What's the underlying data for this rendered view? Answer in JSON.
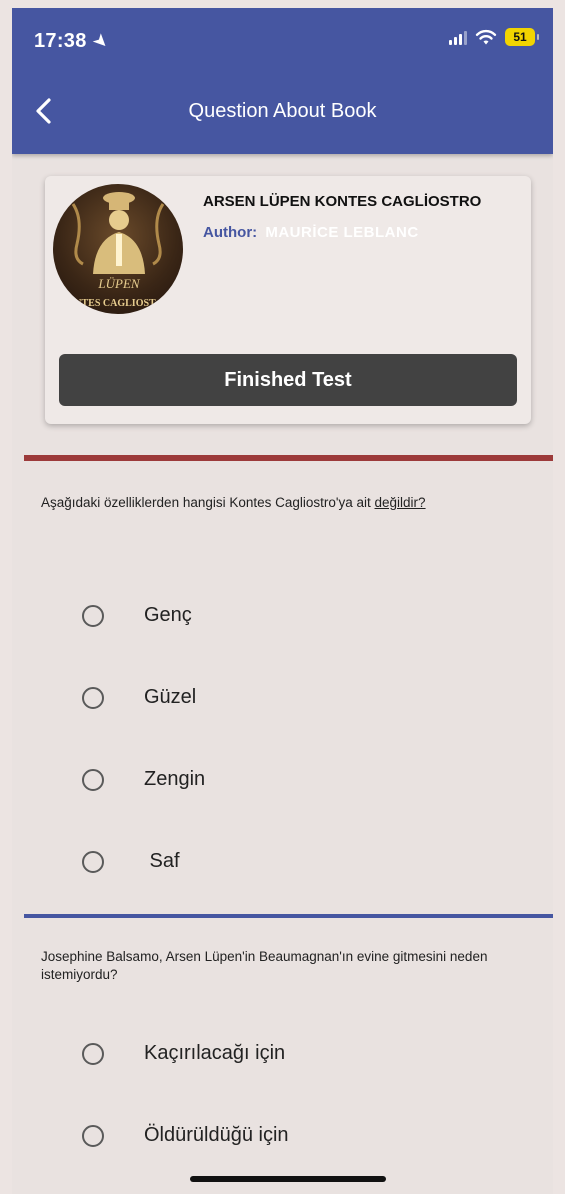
{
  "status_bar": {
    "time": "17:38",
    "battery": "51"
  },
  "header": {
    "title": "Question About Book"
  },
  "book": {
    "title": "ARSEN LÜPEN KONTES CAGLİOSTRO",
    "author_label": "Author:",
    "author_name": "MAURİCE LEBLANC",
    "cover_lines": [
      "LÜPEN",
      "NTES CAGLIOST"
    ]
  },
  "finish_button": {
    "label": "Finished Test"
  },
  "questions": [
    {
      "text_before": "Aşağıdaki özelliklerden hangisi Kontes Cagliostro'ya ait ",
      "text_underlined": "değildir?",
      "options": [
        "Genç",
        "Güzel",
        "Zengin",
        " Saf"
      ]
    },
    {
      "text": "Josephine Balsamo, Arsen Lüpen'in Beaumagnan'ın evine gitmesini neden istemiyordu?",
      "options": [
        "Kaçırılacağı için",
        "Öldürüldüğü için"
      ]
    }
  ],
  "colors": {
    "appbar": "#4656a1",
    "divider_red": "#9c3a3a",
    "divider_blue": "#4656a1",
    "button": "#424242"
  }
}
